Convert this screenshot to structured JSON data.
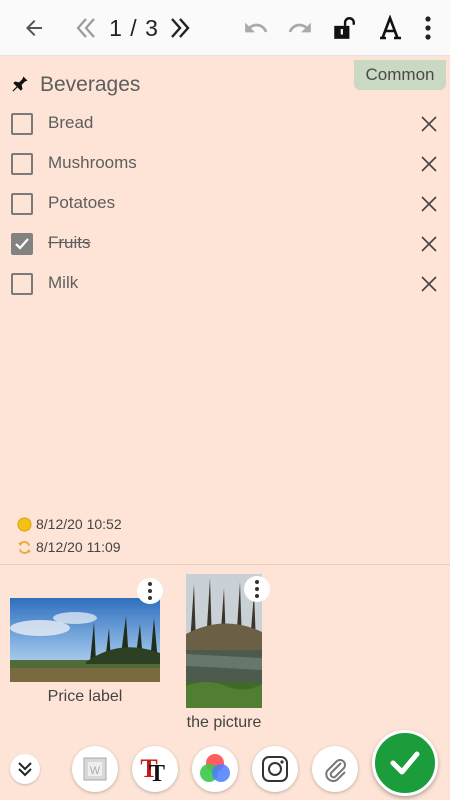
{
  "toolbar": {
    "page_current": "1",
    "page_total": "3",
    "page_indicator": "1 / 3"
  },
  "note": {
    "title": "Beverages",
    "category": "Common",
    "items": [
      {
        "label": "Bread",
        "checked": false
      },
      {
        "label": "Mushrooms",
        "checked": false
      },
      {
        "label": "Potatoes",
        "checked": false
      },
      {
        "label": "Fruits",
        "checked": true
      },
      {
        "label": "Milk",
        "checked": false
      }
    ],
    "created": "8/12/20 10:52",
    "modified": "8/12/20 11:09"
  },
  "attachments": [
    {
      "caption": "Price label"
    },
    {
      "caption": "the picture"
    }
  ],
  "icons": {
    "back": "back-arrow-icon",
    "prev": "double-chevron-left-icon",
    "next": "double-chevron-right-icon",
    "undo": "undo-icon",
    "redo": "redo-icon",
    "lock": "unlocked-padlock-icon",
    "font": "font-format-icon",
    "more": "more-vert-icon"
  },
  "colors": {
    "background": "#fde4d6",
    "category_tag": "#c9d9c3",
    "save_button": "#1c9d3b"
  }
}
